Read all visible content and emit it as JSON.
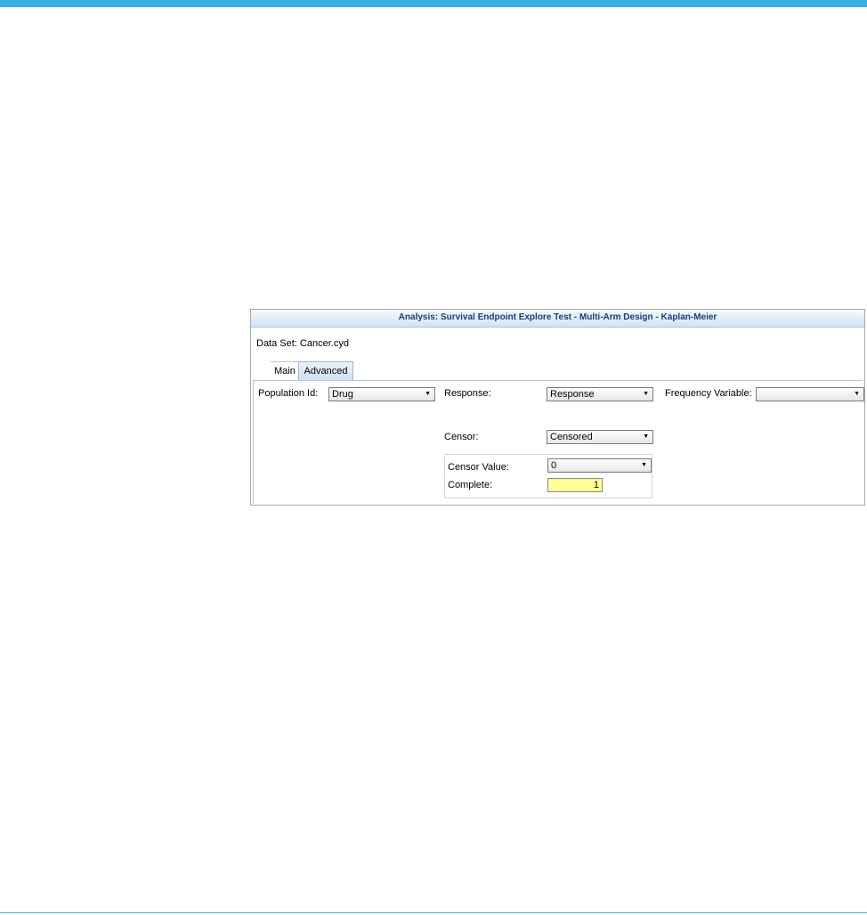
{
  "dialog": {
    "title": "Analysis: Survival Endpoint Explore Test - Multi-Arm Design - Kaplan-Meier",
    "dataset": "Data Set: Cancer.cyd",
    "tabs": [
      "Main",
      "Advanced"
    ],
    "active_tab": "Main"
  },
  "fields": {
    "population_id": {
      "label": "Population Id:",
      "value": "Drug"
    },
    "response": {
      "label": "Response:",
      "value": "Response"
    },
    "frequency_variable": {
      "label": "Frequency Variable:",
      "value": ""
    },
    "censor": {
      "label": "Censor:",
      "value": "Censored"
    },
    "censor_value": {
      "label": "Censor Value:",
      "value": "0"
    },
    "complete": {
      "label": "Complete:",
      "value": "1"
    }
  },
  "icons": {
    "dropdown": "chevron-down-icon"
  },
  "colors": {
    "accent": "#3ab0e2",
    "complete_field": "#ffff99",
    "title_text": "#17407a"
  }
}
